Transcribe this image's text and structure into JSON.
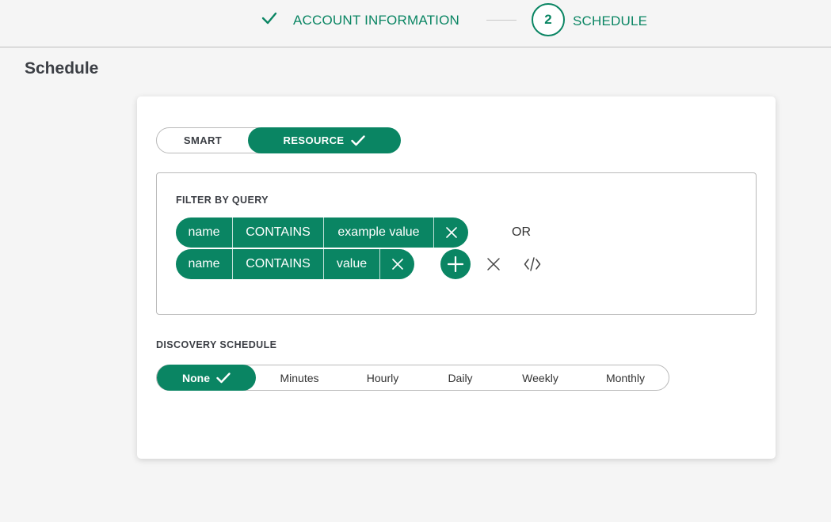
{
  "stepper": {
    "step1": {
      "label": "ACCOUNT INFORMATION",
      "status": "complete",
      "icon": "check-icon"
    },
    "step2": {
      "number": "2",
      "label": "SCHEDULE",
      "status": "current"
    }
  },
  "page": {
    "title": "Schedule"
  },
  "mode_toggle": {
    "options": [
      {
        "label": "SMART",
        "selected": false
      },
      {
        "label": "RESOURCE",
        "selected": true,
        "icon": "check-icon"
      }
    ]
  },
  "filter": {
    "heading": "FILTER BY QUERY",
    "conditions": [
      {
        "field": "name",
        "operator": "CONTAINS",
        "value": "example value",
        "clear_icon": "close-icon"
      },
      {
        "field": "name",
        "operator": "CONTAINS",
        "value": "value",
        "clear_icon": "close-icon"
      }
    ],
    "or_label": "OR",
    "actions": {
      "add_icon": "plus-icon",
      "remove_icon": "close-icon",
      "code_icon": "code-icon"
    }
  },
  "discovery": {
    "heading": "DISCOVERY SCHEDULE",
    "options": [
      {
        "label": "None",
        "selected": true,
        "icon": "check-icon"
      },
      {
        "label": "Minutes",
        "selected": false
      },
      {
        "label": "Hourly",
        "selected": false
      },
      {
        "label": "Daily",
        "selected": false
      },
      {
        "label": "Weekly",
        "selected": false
      },
      {
        "label": "Monthly",
        "selected": false
      }
    ]
  },
  "colors": {
    "accent": "#0a8563",
    "page_bg": "#f5f5f5",
    "card_bg": "#ffffff",
    "border": "#b9b9b9",
    "title_text": "#3b3e44"
  }
}
